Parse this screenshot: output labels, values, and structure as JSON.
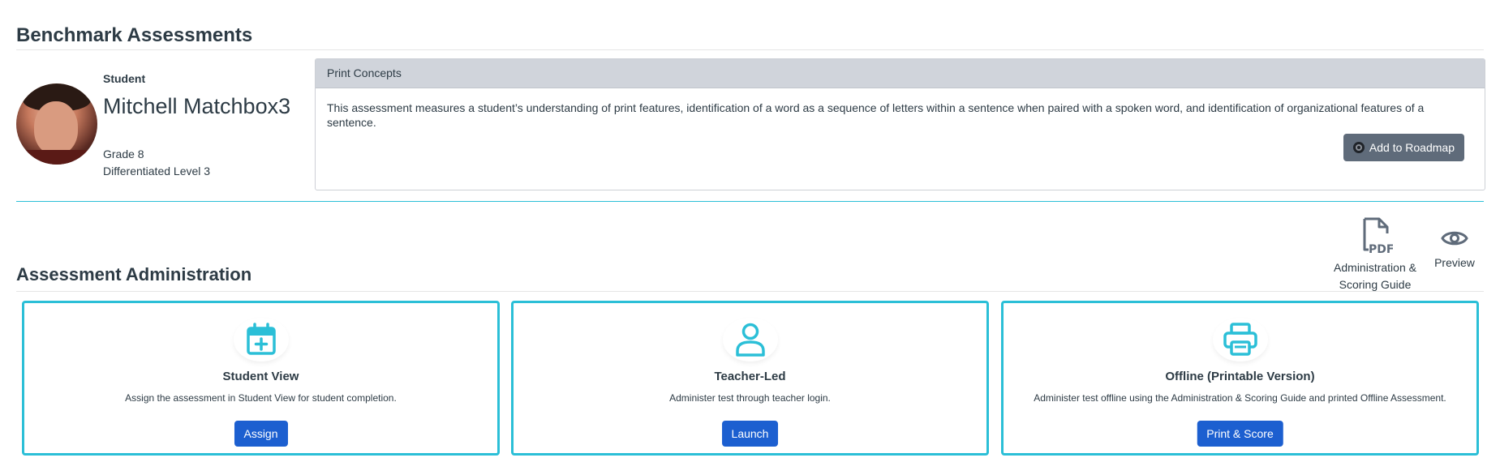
{
  "page": {
    "title": "Benchmark Assessments"
  },
  "student": {
    "label": "Student",
    "name": "Mitchell Matchbox3",
    "grade": "Grade 8",
    "level": "Differentiated Level 3"
  },
  "concept_panel": {
    "title": "Print Concepts",
    "description": "This assessment measures a student’s understanding of print features, identification of a word as a sequence of letters within a sentence when paired with a spoken word, and identification of organizational features of a sentence.",
    "roadmap_button": "Add to Roadmap"
  },
  "tools": {
    "pdf_icon_text": "PDF",
    "guide_label_1": "Administration &",
    "guide_label_2": "Scoring Guide",
    "preview_label": "Preview"
  },
  "administration": {
    "title": "Assessment Administration",
    "cards": [
      {
        "icon": "calendar-plus-icon",
        "title": "Student View",
        "description": "Assign the assessment in Student View for student completion.",
        "button": "Assign"
      },
      {
        "icon": "user-icon",
        "title": "Teacher-Led",
        "description": "Administer test through teacher login.",
        "button": "Launch"
      },
      {
        "icon": "printer-icon",
        "title": "Offline (Printable Version)",
        "description": "Administer test offline using the Administration & Scoring Guide and printed Offline Assessment.",
        "button": "Print & Score"
      }
    ]
  },
  "colors": {
    "accent_teal": "#2bbfd7",
    "primary_blue": "#1c5fd0",
    "roadmap_gray": "#5f6b7a",
    "panel_header": "#d0d4db"
  }
}
